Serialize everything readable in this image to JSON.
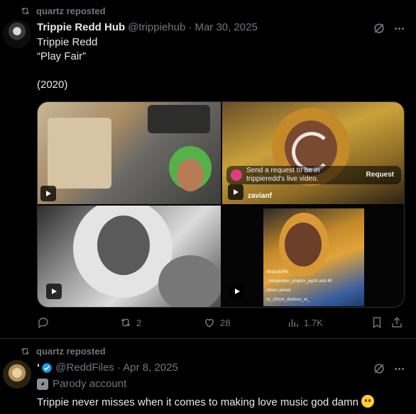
{
  "posts": [
    {
      "repost_label": "quartz reposted",
      "display_name": "Trippie Redd Hub",
      "handle": "@trippiehub",
      "date": "· Mar 30, 2025",
      "text_lines": [
        "Trippie Redd",
        "“Play Fair”",
        "",
        "(2020)"
      ],
      "media": {
        "live_prompt": "Send a request to be in\ntrippieredd's live video.",
        "live_request": "Request",
        "live_user": "zavianf",
        "comments": [
          "lilkaps8249",
          "_oonglooloo_playboi_jay24 and 40",
          "others joined",
          "xx_chrsm_dunnoo_xx_"
        ]
      },
      "actions": {
        "reply_count": "",
        "repost_count": "2",
        "like_count": "28",
        "view_count": "1.7K"
      }
    },
    {
      "repost_label": "quartz reposted",
      "display_name": "‘",
      "handle": "@ReddFiles",
      "date": "· Apr 8, 2025",
      "badge": "Parody account",
      "text": "Trippie never misses when it comes to making love music god damn"
    }
  ],
  "icons": [
    "repost-icon",
    "grok-icon",
    "more-icon",
    "reply-icon",
    "like-icon",
    "views-icon",
    "bookmark-icon",
    "share-icon",
    "verified-icon",
    "play-icon",
    "parody-mask-icon",
    "pleading-face-emoji"
  ],
  "colors": {
    "background": "#000000",
    "text": "#e7e9ea",
    "muted": "#71767b",
    "verified": "#1d9bf0",
    "divider": "#2f3336"
  }
}
